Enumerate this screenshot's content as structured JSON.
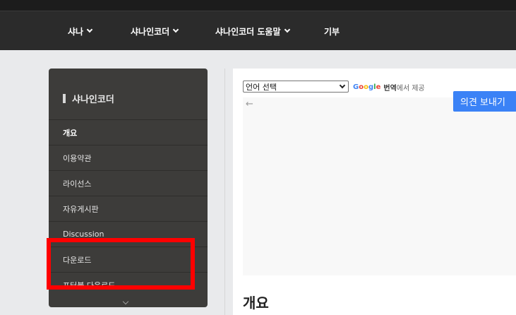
{
  "nav": {
    "items": [
      {
        "label": "샤나",
        "dropdown": true
      },
      {
        "label": "샤나인코더",
        "dropdown": true
      },
      {
        "label": "샤나인코더 도움말",
        "dropdown": true
      },
      {
        "label": "기부",
        "dropdown": false
      }
    ]
  },
  "sidebar": {
    "title": "샤나인코더",
    "items": [
      {
        "label": "개요",
        "active": true
      },
      {
        "label": "이용약관"
      },
      {
        "label": "라이선스"
      },
      {
        "label": "자유게시판"
      },
      {
        "label": "Discussion"
      },
      {
        "label": "다운로드"
      },
      {
        "label": "포터블 다운로드"
      }
    ]
  },
  "translate": {
    "select_value": "언어 선택",
    "google_letters": [
      "G",
      "o",
      "o",
      "g",
      "l",
      "e"
    ],
    "translate_word": "번역",
    "tail": "에서 제공"
  },
  "frame": {
    "back_icon": "back-arrow-icon",
    "feedback_label": "의견 보내기"
  },
  "content": {
    "heading": "개요"
  },
  "colors": {
    "navbar": "#2b2b2b",
    "sidebar": "#3d3c3a",
    "highlight": "#ff0000",
    "feedback_button": "#3b82f6"
  }
}
